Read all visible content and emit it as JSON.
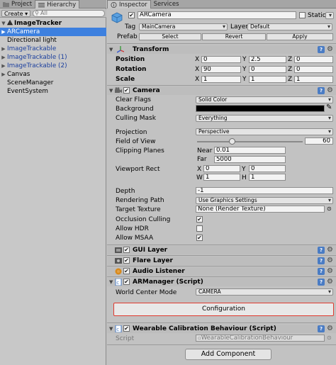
{
  "tabs_left": [
    {
      "label": "Project"
    },
    {
      "label": "Hierarchy"
    }
  ],
  "tabs_right": [
    {
      "label": "Inspector"
    },
    {
      "label": "Services"
    }
  ],
  "hierarchy": {
    "create_label": "Create",
    "search_placeholder": "All",
    "items": [
      {
        "label": "ImageTracker"
      },
      {
        "label": "ARCamera"
      },
      {
        "label": "Directional light"
      },
      {
        "label": "ImageTrackable"
      },
      {
        "label": "ImageTrackable (1)"
      },
      {
        "label": "ImageTrackable (2)"
      },
      {
        "label": "Canvas"
      },
      {
        "label": "SceneManager"
      },
      {
        "label": "EventSystem"
      }
    ]
  },
  "object": {
    "name": "ARCamera",
    "static_label": "Static",
    "tag_label": "Tag",
    "tag_value": "MainCamera",
    "layer_label": "Layer",
    "layer_value": "Default",
    "prefab_label": "Prefab",
    "select_label": "Select",
    "revert_label": "Revert",
    "apply_label": "Apply"
  },
  "transform": {
    "title": "Transform",
    "position_label": "Position",
    "rotation_label": "Rotation",
    "scale_label": "Scale",
    "x": "X",
    "y": "Y",
    "z": "Z",
    "position": [
      "0",
      "2.5",
      "0"
    ],
    "rotation": [
      "90",
      "0",
      "0"
    ],
    "scale": [
      "1",
      "1",
      "1"
    ]
  },
  "camera": {
    "title": "Camera",
    "clear_flags_label": "Clear Flags",
    "clear_flags_value": "Solid Color",
    "background_label": "Background",
    "culling_mask_label": "Culling Mask",
    "culling_mask_value": "Everything",
    "projection_label": "Projection",
    "projection_value": "Perspective",
    "fov_label": "Field of View",
    "fov_value": "60",
    "clipping_label": "Clipping Planes",
    "near_label": "Near",
    "near_value": "0.01",
    "far_label": "Far",
    "far_value": "5000",
    "viewport_label": "Viewport Rect",
    "vp_x_label": "X",
    "vp_x": "0",
    "vp_y_label": "Y",
    "vp_y": "0",
    "vp_w_label": "W",
    "vp_w": "1",
    "vp_h_label": "H",
    "vp_h": "1",
    "depth_label": "Depth",
    "depth_value": "-1",
    "rendering_path_label": "Rendering Path",
    "rendering_path_value": "Use Graphics Settings",
    "target_texture_label": "Target Texture",
    "target_texture_value": "None (Render Texture)",
    "occlusion_label": "Occlusion Culling",
    "hdr_label": "Allow HDR",
    "msaa_label": "Allow MSAA",
    "occlusion_checked": true,
    "hdr_checked": false,
    "msaa_checked": true,
    "fov_fraction": 0.33
  },
  "components": {
    "gui_layer": "GUI Layer",
    "flare_layer": "Flare Layer",
    "audio_listener": "Audio Listener",
    "armanager": "ARManager (Script)",
    "world_center_label": "World Center Mode",
    "world_center_value": "CAMERA",
    "configuration_label": "Configuration",
    "wearable": "Wearable Calibration Behaviour (Script)",
    "script_label": "Script",
    "script_value": "WearableCalibrationBehaviour",
    "add_component_label": "Add Component"
  },
  "colors": {
    "selection": "#3d80df",
    "prefab_blue": "#1b3f9e",
    "config_outline": "#e03a2f"
  }
}
